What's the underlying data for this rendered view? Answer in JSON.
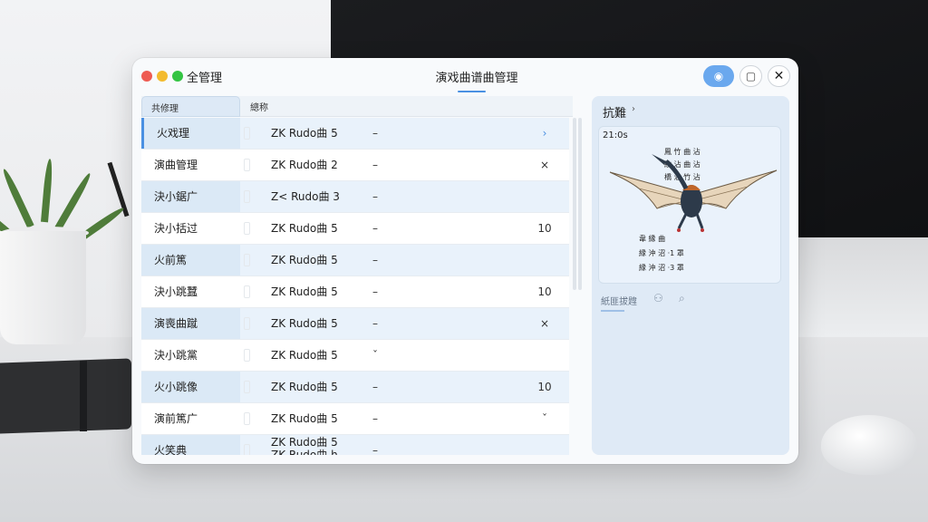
{
  "window": {
    "app_name": "全管理",
    "title": "演戏曲谱曲管理",
    "toolbar": {
      "primary_icon": "location-pin-icon",
      "restore_icon": "window-restore-icon",
      "close_icon": "close-icon",
      "close_glyph": "✕",
      "restore_glyph": "▢",
      "primary_glyph": "◉"
    }
  },
  "table": {
    "headers": [
      "共修理",
      "總称"
    ],
    "rows": [
      {
        "name": "火戏理",
        "song": "ZK Rudo曲 5",
        "dash": "–",
        "action": "›",
        "selected": true
      },
      {
        "name": "演曲管理",
        "song": "ZK Rudo曲 2",
        "dash": "–",
        "action": "×"
      },
      {
        "name": "決小鋸广",
        "song": "Z< Rudo曲 3",
        "dash": "–",
        "action": ""
      },
      {
        "name": "決小括过",
        "song": "ZK Rudo曲 5",
        "dash": "–",
        "action": "10"
      },
      {
        "name": "火前篤",
        "song": "ZK Rudo曲 5",
        "dash": "–",
        "action": ""
      },
      {
        "name": "決小跳蠶",
        "song": "ZK Rudo曲 5",
        "dash": "–",
        "action": "10"
      },
      {
        "name": "演喪曲蹴",
        "song": "ZK Rudo曲 5",
        "dash": "–",
        "action": "×"
      },
      {
        "name": "決小跳黨",
        "song": "ZK Rudo曲 5",
        "dash": "ˇ",
        "action": ""
      },
      {
        "name": "火小跳像",
        "song": "ZK Rudo曲 5",
        "dash": "–",
        "action": "10"
      },
      {
        "name": "演前篤广",
        "song": "ZK Rudo曲 5",
        "dash": "–",
        "action": "ˇ"
      },
      {
        "name": "火笑典",
        "song": "ZK Rudo曲 5",
        "song2": "ZK Rudo曲 h",
        "dash": "–",
        "action": ""
      }
    ]
  },
  "panel": {
    "title": "抗難",
    "caret": "›",
    "preview": {
      "tag": "21:0s",
      "captions_top": [
        "鳳 竹 曲 沾",
        "紋 沾 曲 沾",
        "橋 沾 竹 沾"
      ],
      "captions_bottom": [
        "韋 縁 曲",
        "縁 沖 沼 ·1 罩",
        "縁 沖 沼 ·3 罩"
      ],
      "image_alt": "pterosaur illustration"
    },
    "tools": {
      "label": "紙匪拔韙",
      "icon1": "person-icon",
      "icon2": "search-icon"
    }
  }
}
